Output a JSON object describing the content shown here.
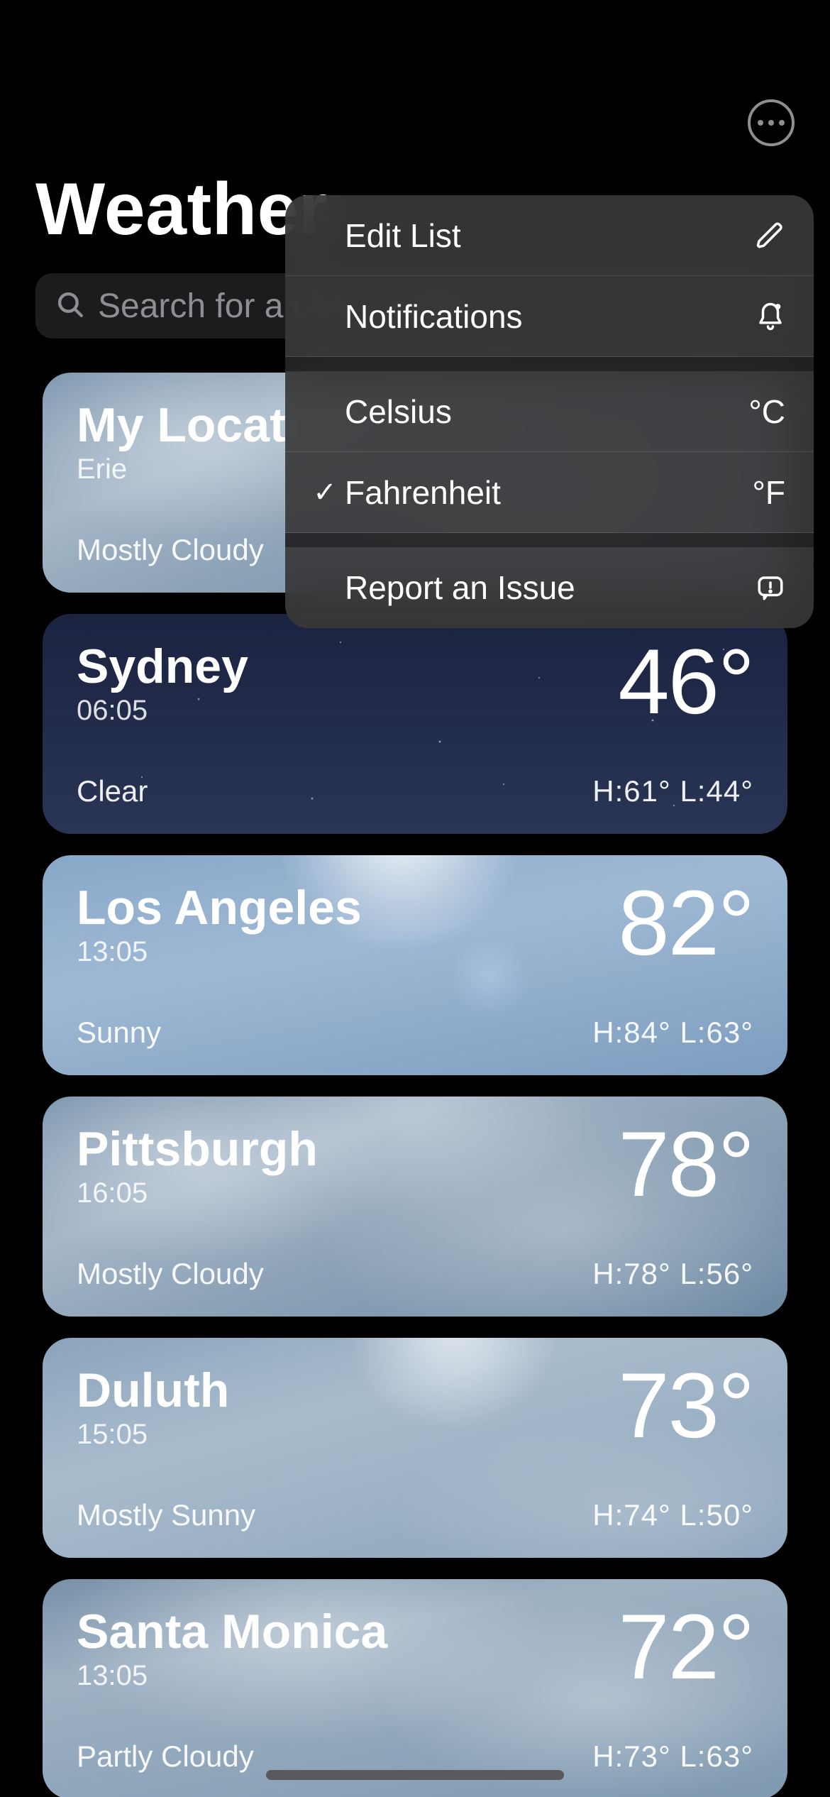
{
  "header": {
    "title": "Weather"
  },
  "search": {
    "placeholder": "Search for a city or airport"
  },
  "menu": {
    "items": [
      {
        "label": "Edit List",
        "checked": false,
        "right_text": "",
        "icon": "pencil"
      },
      {
        "label": "Notifications",
        "checked": false,
        "right_text": "",
        "icon": "bell"
      },
      {
        "label": "Celsius",
        "checked": false,
        "right_text": "°C",
        "icon": ""
      },
      {
        "label": "Fahrenheit",
        "checked": true,
        "right_text": "°F",
        "icon": ""
      },
      {
        "label": "Report an Issue",
        "checked": false,
        "right_text": "",
        "icon": "report"
      }
    ]
  },
  "locations": [
    {
      "city": "My Location",
      "subline": "Erie",
      "temp": "",
      "condition": "Mostly Cloudy",
      "hilo": "",
      "bg": "bg-cloudy"
    },
    {
      "city": "Sydney",
      "subline": "06:05",
      "temp": "46°",
      "condition": "Clear",
      "hilo": "H:61°  L:44°",
      "bg": "bg-night"
    },
    {
      "city": "Los Angeles",
      "subline": "13:05",
      "temp": "82°",
      "condition": "Sunny",
      "hilo": "H:84°  L:63°",
      "bg": "bg-sunny"
    },
    {
      "city": "Pittsburgh",
      "subline": "16:05",
      "temp": "78°",
      "condition": "Mostly Cloudy",
      "hilo": "H:78°  L:56°",
      "bg": "bg-cloudy"
    },
    {
      "city": "Duluth",
      "subline": "15:05",
      "temp": "73°",
      "condition": "Mostly Sunny",
      "hilo": "H:74°  L:50°",
      "bg": "bg-mostlysunny"
    },
    {
      "city": "Santa Monica",
      "subline": "13:05",
      "temp": "72°",
      "condition": "Partly Cloudy",
      "hilo": "H:73°  L:63°",
      "bg": "bg-partlycloudy"
    }
  ]
}
